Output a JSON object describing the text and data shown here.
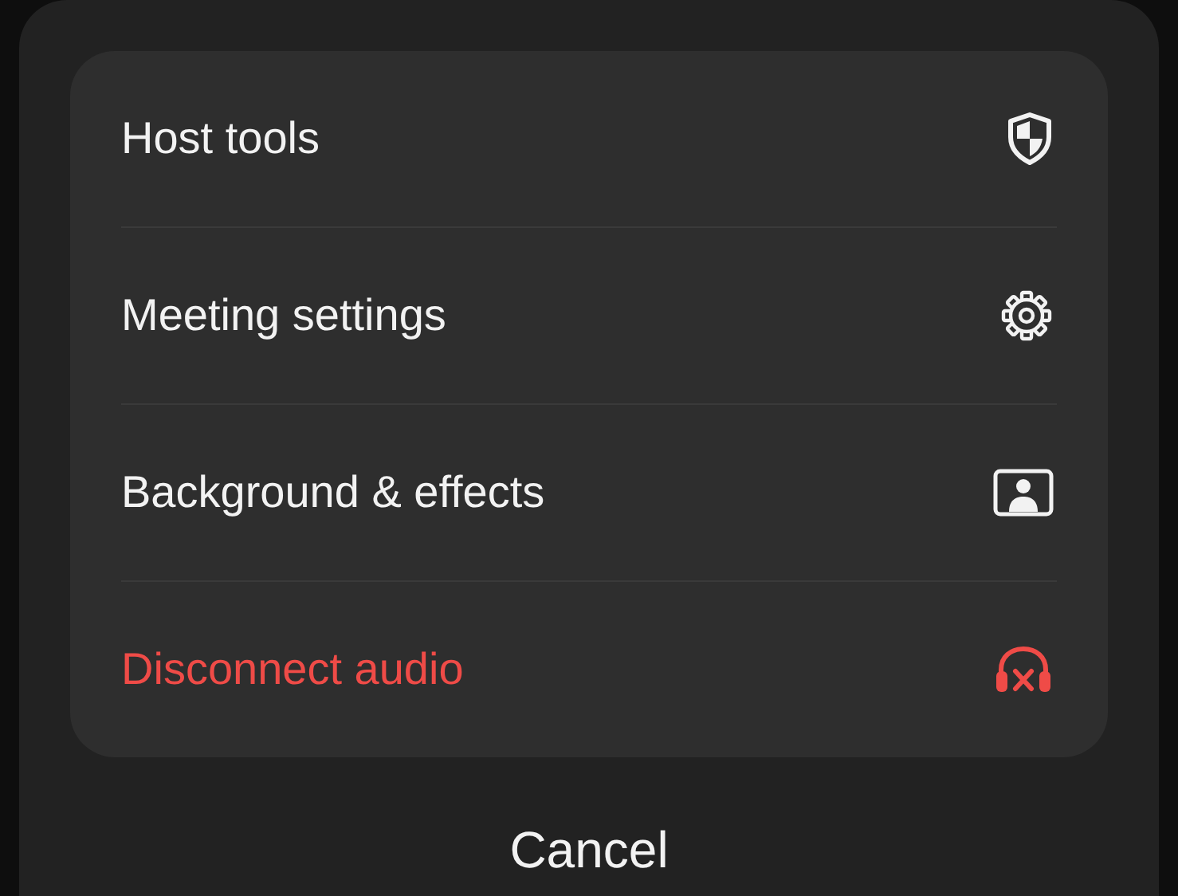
{
  "menu": {
    "items": [
      {
        "label": "Host tools",
        "kind": "normal"
      },
      {
        "label": "Meeting settings",
        "kind": "normal"
      },
      {
        "label": "Background & effects",
        "kind": "normal"
      },
      {
        "label": "Disconnect audio",
        "kind": "destructive"
      }
    ]
  },
  "cancel": "Cancel"
}
